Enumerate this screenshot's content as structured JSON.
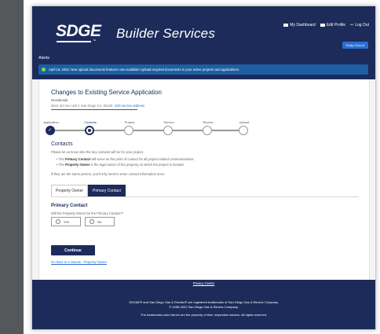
{
  "header": {
    "logo": "SDGE",
    "logo_tm": "™",
    "title": "Builder Services",
    "nav": [
      {
        "label": "My Dashboard"
      },
      {
        "label": "Edit Profile"
      },
      {
        "label": "Log Out"
      }
    ],
    "user_button": "Rudy Chen ▾"
  },
  "alerts": {
    "title": "Alerts",
    "message": "April 18, 2022: New upload documents features now available! Upload required documents to your active projects and applications."
  },
  "application": {
    "title": "Changes to Existing Service Application",
    "type": "Residential",
    "address": "3644 3rd Ave Unit 1 San Diego CA, 92103",
    "edit_link": "Edit service address"
  },
  "steps": [
    {
      "label": "Application",
      "state": "done"
    },
    {
      "label": "Contacts",
      "state": "current"
    },
    {
      "label": "Project",
      "state": "pending"
    },
    {
      "label": "Service",
      "state": "pending"
    },
    {
      "label": "Review",
      "state": "pending"
    },
    {
      "label": "Upload",
      "state": "pending"
    }
  ],
  "contacts": {
    "heading": "Contacts",
    "intro": "Please let us know who the key contacts will be for your project.",
    "bullet1_bold": "Primary Contact",
    "bullet1_rest": "will serve as the point of contact for all project related communications.",
    "bullet2_bold": "Property Owner",
    "bullet2_rest": "is the legal owner of the property on which the project is located.",
    "bullet_prefix": "The",
    "same_person_note": "If they are the same person, you'll only need to enter contact information once."
  },
  "tabs": [
    {
      "label": "Property Owner",
      "active": false
    },
    {
      "label": "Primary Contact",
      "active": true
    }
  ],
  "primary_contact": {
    "heading": "Primary Contact",
    "question": "Will the Property Owner be the Primary Contact?",
    "required_mark": "*",
    "options": [
      "Yes",
      "No"
    ]
  },
  "actions": {
    "continue": "Continue",
    "back_link": "Go back to Contacts - Property Owner"
  },
  "footer": {
    "privacy": "Privacy Center",
    "line1": "SDG&E® and San Diego Gas & Electric® are registered trademarks of San Diego Gas & Electric Company.",
    "line2": "© 1998-2022 San Diego Gas & Electric Company.",
    "line3": "The trademarks used herein are the property of their respective owners. All rights reserved."
  },
  "colors": {
    "navy": "#1c2b59",
    "alert_blue": "#1d5fa3",
    "link_blue": "#2d6fd1"
  }
}
